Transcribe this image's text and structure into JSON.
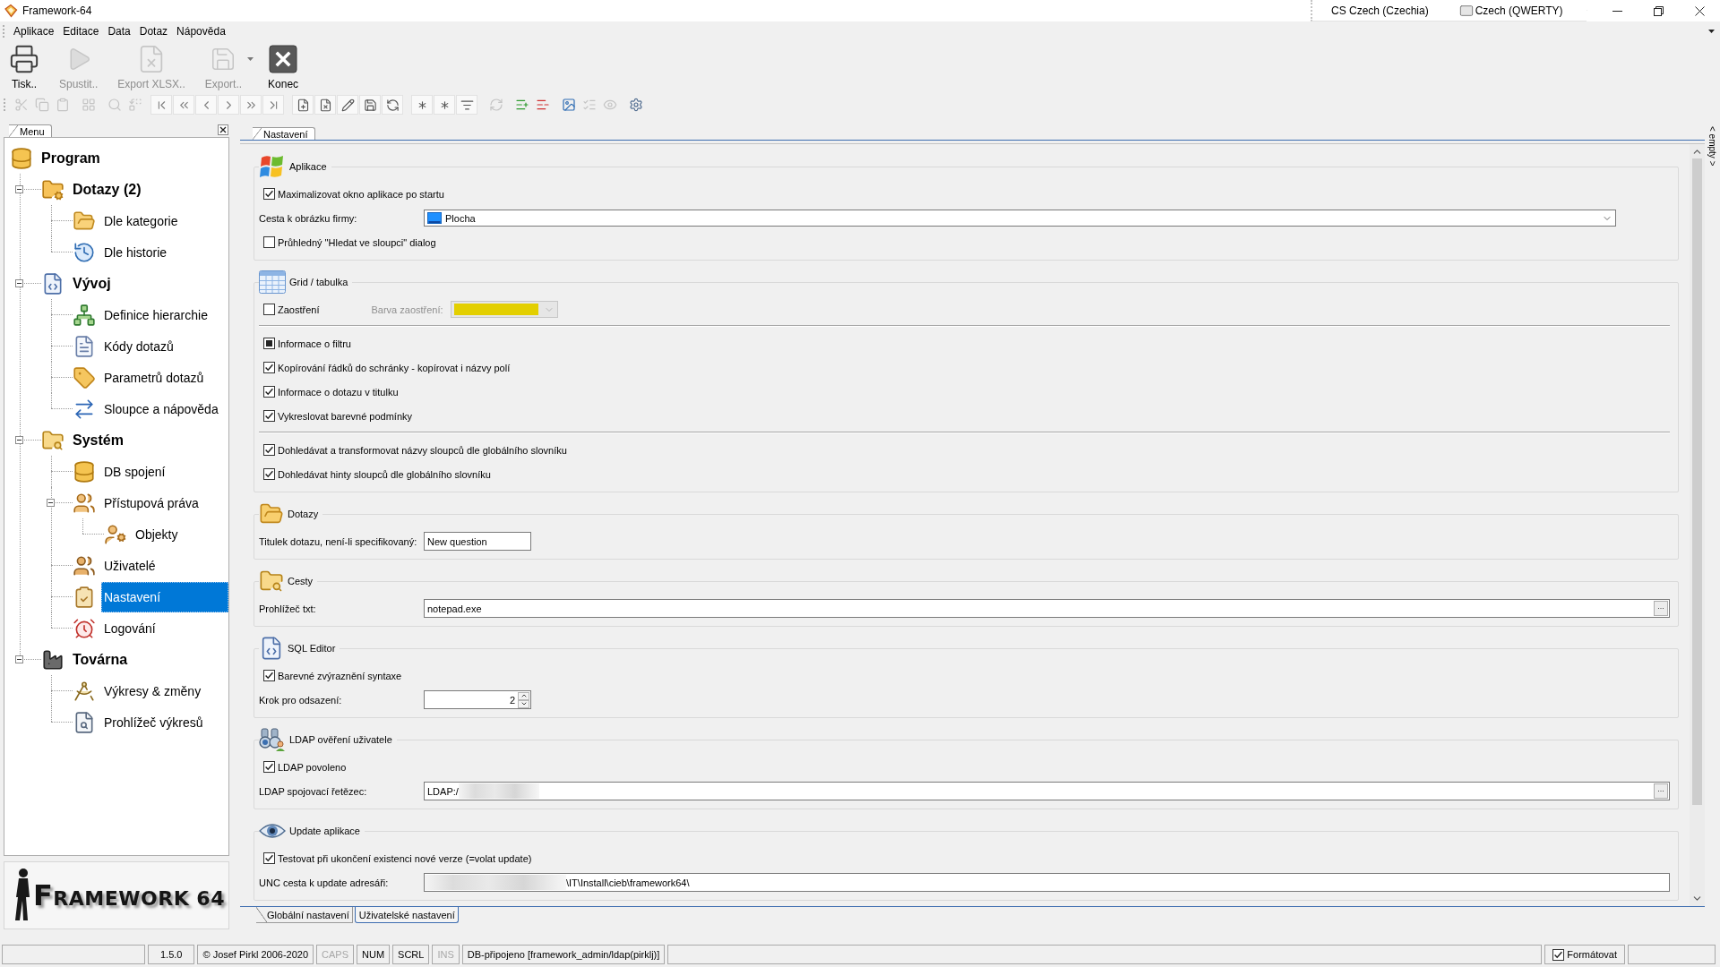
{
  "window": {
    "title": "Framework-64"
  },
  "language_bar": {
    "language": "CS Czech (Czechia)",
    "keyboard": "Czech (QWERTY)"
  },
  "menu": [
    "Aplikace",
    "Editace",
    "Data",
    "Dotaz",
    "Nápověda"
  ],
  "toolbar": [
    {
      "label": "Tisk..",
      "disabled": false,
      "has_menu": false
    },
    {
      "label": "Spustit..",
      "disabled": true,
      "has_menu": false
    },
    {
      "label": "Export XLSX..",
      "disabled": true,
      "has_menu": false
    },
    {
      "label": "Export..",
      "disabled": true,
      "has_menu": true
    },
    {
      "label": "Konec",
      "disabled": false,
      "has_menu": false
    }
  ],
  "icon_toolbar": [
    {
      "boxed": false,
      "buttons": [
        {
          "disabled": true
        },
        {
          "disabled": true
        },
        {
          "disabled": true
        }
      ]
    },
    {
      "boxed": false,
      "buttons": [
        {
          "disabled": true
        }
      ]
    },
    {
      "boxed": false,
      "buttons": [
        {
          "disabled": true
        },
        {
          "disabled": true
        }
      ]
    },
    {
      "boxed": true,
      "buttons": [
        {
          "disabled": false
        },
        {
          "disabled": false
        },
        {
          "disabled": false
        },
        {
          "disabled": false
        },
        {
          "disabled": false
        },
        {
          "disabled": false
        }
      ]
    },
    {
      "boxed": true,
      "buttons": [
        {
          "disabled": false
        },
        {
          "disabled": false
        },
        {
          "disabled": false
        },
        {
          "disabled": false
        },
        {
          "disabled": false
        }
      ]
    },
    {
      "boxed": true,
      "buttons": [
        {
          "disabled": false
        },
        {
          "disabled": false
        },
        {
          "disabled": false
        }
      ]
    },
    {
      "boxed": false,
      "buttons": [
        {
          "disabled": true
        }
      ]
    },
    {
      "boxed": false,
      "buttons": [
        {
          "disabled": false
        },
        {
          "disabled": false
        }
      ]
    },
    {
      "boxed": false,
      "buttons": [
        {
          "disabled": false
        },
        {
          "disabled": true
        },
        {
          "disabled": true
        }
      ]
    },
    {
      "boxed": false,
      "buttons": [
        {
          "disabled": false
        }
      ]
    }
  ],
  "left_panel": {
    "tabs": [
      {
        "label": "Menu",
        "selected": true
      }
    ],
    "tree": [
      {
        "label": "Program",
        "selected": false,
        "children": [
          {
            "label": "Dotazy (2)",
            "expanded": true,
            "selected": false,
            "children": [
              {
                "label": "Dle kategorie",
                "selected": false
              },
              {
                "label": "Dle historie",
                "selected": false
              }
            ]
          },
          {
            "label": "Vývoj",
            "expanded": true,
            "selected": false,
            "children": [
              {
                "label": "Definice hierarchie",
                "selected": false
              },
              {
                "label": "Kódy dotazů",
                "selected": false
              },
              {
                "label": "Parametrů dotazů",
                "selected": false
              },
              {
                "label": "Sloupce a nápověda",
                "selected": false
              }
            ]
          },
          {
            "label": "Systém",
            "expanded": true,
            "selected": false,
            "children": [
              {
                "label": "DB spojení",
                "selected": false
              },
              {
                "label": "Přístupová práva",
                "expanded": true,
                "selected": false,
                "children": [
                  {
                    "label": "Objekty",
                    "selected": false
                  }
                ]
              },
              {
                "label": "Uživatelé",
                "selected": false
              },
              {
                "label": "Nastavení",
                "selected": true
              },
              {
                "label": "Logování",
                "selected": false
              }
            ]
          },
          {
            "label": "Továrna",
            "expanded": true,
            "selected": false,
            "children": [
              {
                "label": "Výkresy & změny",
                "selected": false
              },
              {
                "label": "Prohlížeč výkresů",
                "selected": false
              }
            ]
          }
        ]
      }
    ],
    "logo": "FRAMEWORK 64"
  },
  "settings": {
    "tabs": [
      {
        "label": "Nastavení",
        "selected": true
      }
    ],
    "sections": [
      {
        "title": "Aplikace",
        "rows": [
          {
            "kind": "checkbox",
            "label": "Maximalizovat okno aplikace po startu",
            "checked": true,
            "indeterminate": false
          },
          {
            "kind": "dropdown",
            "label": "Cesta k obrázku firmy:",
            "value": "Plocha"
          },
          {
            "kind": "checkbox",
            "label": "Průhledný \"Hledat ve sloupci\" dialog",
            "checked": false,
            "indeterminate": false
          }
        ]
      },
      {
        "title": "Grid / tabulka",
        "rows": [
          {
            "kind": "colorpick",
            "label": "Zaostření",
            "checked": false,
            "indeterminate": false,
            "color_label": "Barva zaostření:",
            "color": "#e3cf00",
            "disabled": true
          },
          {
            "kind": "separator"
          },
          {
            "kind": "checkbox",
            "label": "Informace o filtru",
            "checked": false,
            "indeterminate": true
          },
          {
            "kind": "checkbox",
            "label": "Kopírování řádků do schránky - kopírovat i názvy polí",
            "checked": true,
            "indeterminate": false
          },
          {
            "kind": "checkbox",
            "label": "Informace o dotazu v titulku",
            "checked": true,
            "indeterminate": false
          },
          {
            "kind": "checkbox",
            "label": "Vykreslovat barevné podmínky",
            "checked": true,
            "indeterminate": false
          },
          {
            "kind": "separator"
          },
          {
            "kind": "checkbox",
            "label": "Dohledávat a transformovat názvy sloupců dle globálního slovníku",
            "checked": true,
            "indeterminate": false
          },
          {
            "kind": "checkbox",
            "label": "Dohledávat hinty sloupců dle globálního slovníku",
            "checked": true,
            "indeterminate": false
          }
        ]
      },
      {
        "title": "Dotazy",
        "rows": [
          {
            "kind": "field",
            "label": "Titulek dotazu, není-li specifikovaný:",
            "value": "New question"
          }
        ]
      },
      {
        "title": "Cesty",
        "rows": [
          {
            "kind": "browse",
            "label": "Prohlížeč txt:",
            "value_parts": [
              {
                "kind": "text",
                "text": "notepad.exe"
              }
            ],
            "button": "..."
          }
        ]
      },
      {
        "title": "SQL Editor",
        "rows": [
          {
            "kind": "checkbox",
            "label": "Barevné zvýraznění syntaxe",
            "checked": true,
            "indeterminate": false
          },
          {
            "kind": "spin",
            "label": "Krok pro odsazení:",
            "value": "2"
          }
        ]
      },
      {
        "title": "LDAP ověření uživatele",
        "rows": [
          {
            "kind": "checkbox",
            "label": "LDAP povoleno",
            "checked": true,
            "indeterminate": false
          },
          {
            "kind": "browse",
            "label": "LDAP spojovací řetězec:",
            "value_parts": [
              {
                "kind": "text",
                "text": "LDAP:/"
              },
              {
                "kind": "blurred"
              }
            ],
            "button": "..."
          }
        ]
      },
      {
        "title": "Update aplikace",
        "rows": [
          {
            "kind": "checkbox",
            "label": "Testovat při ukončení existenci nové verze (=volat update)",
            "checked": true,
            "indeterminate": false
          },
          {
            "kind": "wide",
            "label": "UNC cesta k update adresáři:",
            "value_parts": [
              {
                "kind": "blurred"
              },
              {
                "kind": "text",
                "text": "\\IT\\Install\\cieb\\framework64\\"
              }
            ]
          }
        ]
      }
    ],
    "bottom_tabs": [
      {
        "label": "Globální nastavení",
        "selected": true
      },
      {
        "label": "Uživatelské nastavení",
        "selected": false
      }
    ]
  },
  "side_tab": "< empty >",
  "status_bar": {
    "panels": [
      {
        "text": "1.5.0",
        "disabled": false
      },
      {
        "text": "© Josef Pirkl 2006-2020",
        "disabled": false
      },
      {
        "text": "CAPS",
        "disabled": true
      },
      {
        "text": "NUM",
        "disabled": false
      },
      {
        "text": "SCRL",
        "disabled": false
      },
      {
        "text": "INS",
        "disabled": true
      },
      {
        "text": "DB-připojeno [framework_admin/ldap(pirklj)]",
        "disabled": false
      }
    ],
    "format": {
      "label": "Formátovat",
      "checked": true
    }
  }
}
